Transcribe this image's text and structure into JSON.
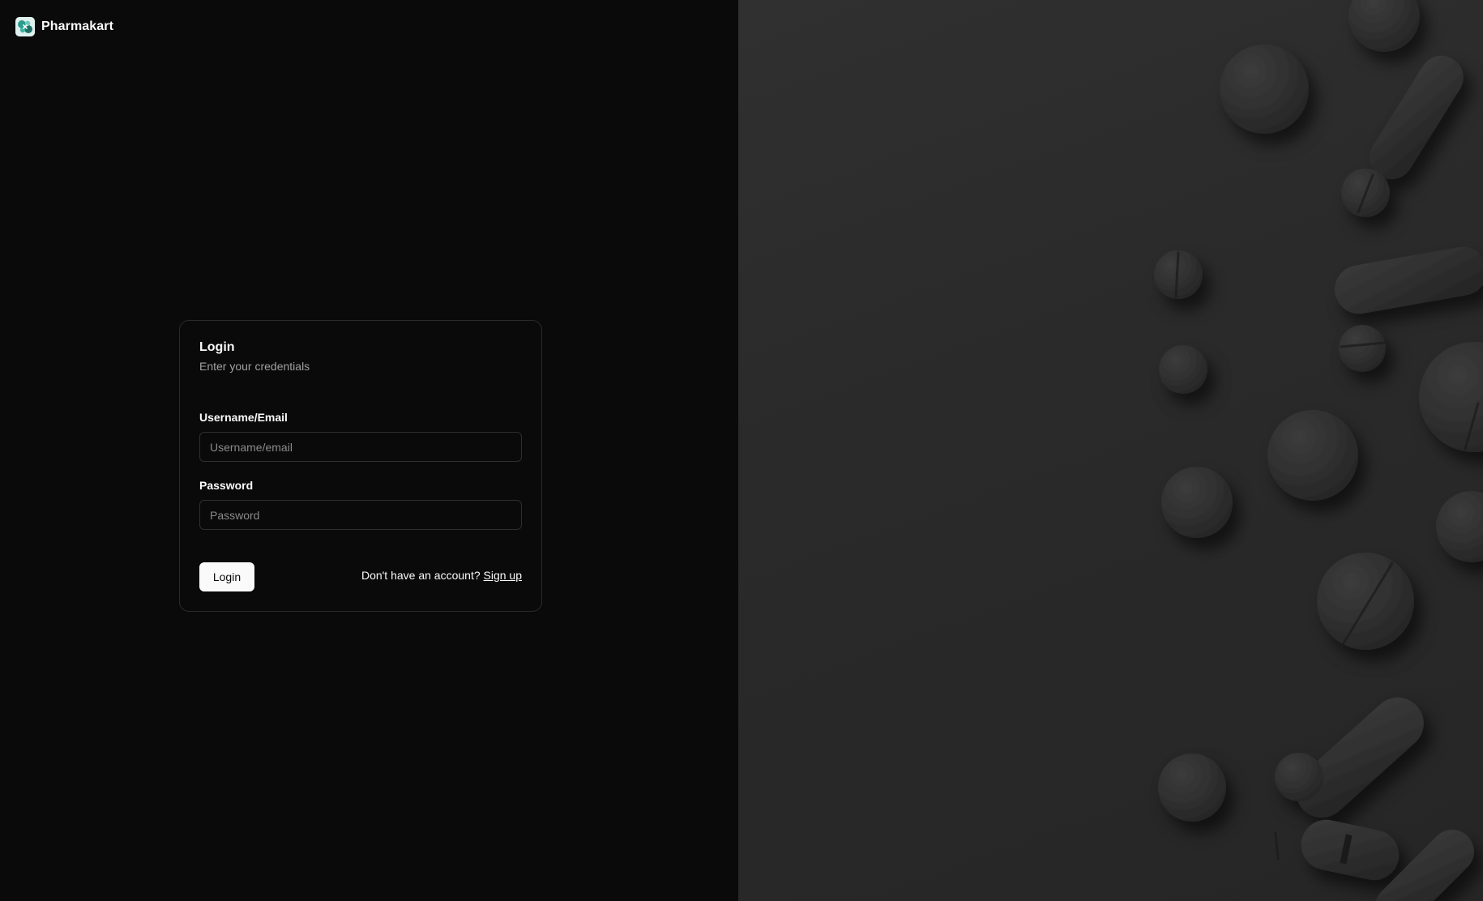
{
  "brand": {
    "name": "Pharmakart",
    "logo_icon": "pharmakart-logo-icon"
  },
  "login_card": {
    "title": "Login",
    "subtitle": "Enter your credentials",
    "username": {
      "label": "Username/Email",
      "placeholder": "Username/email",
      "value": ""
    },
    "password": {
      "label": "Password",
      "placeholder": "Password",
      "value": ""
    },
    "submit_label": "Login",
    "signup_prompt": "Don't have an account?",
    "signup_link": "Sign up"
  },
  "hero_image": {
    "subject": "pills-and-capsules-image"
  },
  "colors": {
    "background": "#0a0a0a",
    "card_border": "#2a2a2a",
    "button_bg": "#fafafa",
    "button_text": "#0a0a0a",
    "muted_text": "#a1a1a1",
    "logo_accent": "#2a9d8f"
  }
}
